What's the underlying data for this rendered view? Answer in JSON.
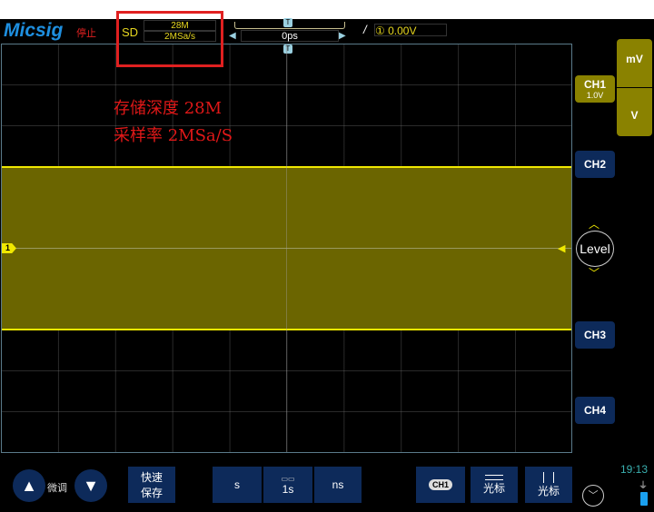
{
  "header": {
    "brand": "Micsig",
    "status": "停止",
    "sd_label": "SD",
    "memory_depth": "28M",
    "sample_rate": "2MSa/s",
    "time_offset": "0ps",
    "trigger_marker": "T",
    "trigger_channel": "①",
    "trigger_level": "0.00V"
  },
  "annotation": {
    "line1": "存储深度 28M",
    "line2": "采样率  2MSa/S"
  },
  "plot": {
    "channel_marker": "1"
  },
  "right_panel": {
    "unit_mv": "mV",
    "unit_v": "V",
    "ch1_label": "CH1",
    "ch1_scale": "1.0V",
    "ch2_label": "CH2",
    "level_label": "Level",
    "ch3_label": "CH3",
    "ch4_label": "CH4"
  },
  "bottom": {
    "fine_tune": "微调",
    "quick_save_1": "快速",
    "quick_save_2": "保存",
    "time_s": "s",
    "timebase": "1s",
    "time_ns": "ns",
    "ch1_stack": "CH1",
    "cursor_h": "光标",
    "cursor_v": "光标",
    "clock": "19:13"
  },
  "colors": {
    "ch1": "#f0e800",
    "button": "#0d2a5a",
    "annotation": "#e01818"
  }
}
